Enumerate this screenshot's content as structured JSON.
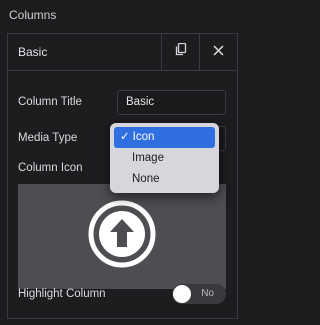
{
  "section_title": "Columns",
  "item": {
    "title": "Basic",
    "copy_icon": "copy-icon",
    "close_icon": "close-icon"
  },
  "fields": {
    "column_title_label": "Column Title",
    "column_title_value": "Basic",
    "media_type_label": "Media Type",
    "column_icon_label": "Column Icon",
    "highlight_label": "Highlight Column",
    "highlight_state": "No"
  },
  "media_type_menu": {
    "selected": "Icon",
    "options": [
      "Icon",
      "Image",
      "None"
    ],
    "check_glyph": "✓"
  },
  "icon_preview": "arrow-up-circle-icon",
  "colors": {
    "accent": "#2f6fe0",
    "panel_bg": "#1d1d20",
    "icon_area_bg": "#4d4d52"
  }
}
